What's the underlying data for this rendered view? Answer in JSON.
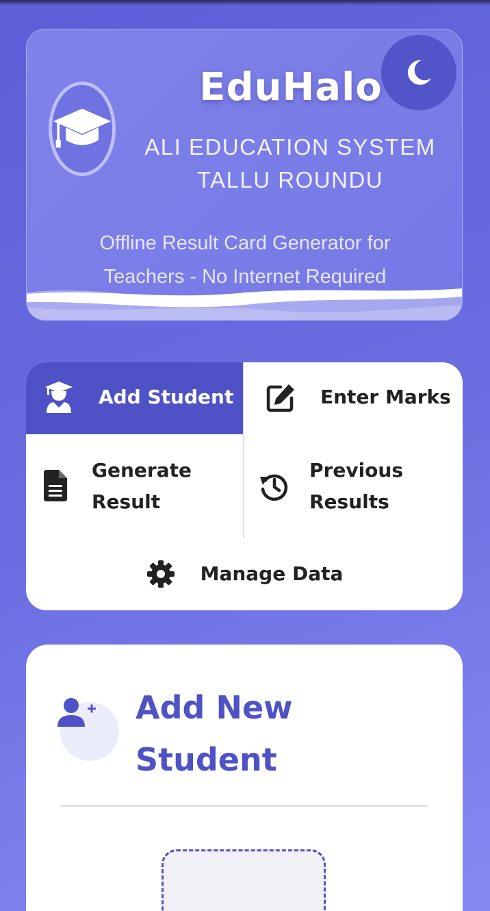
{
  "header": {
    "app_name": "EduHalo",
    "school_line1": "ALI EDUCATION SYSTEM",
    "school_line2": "TALLU ROUNDU",
    "tagline_line1": "Offline Result Card Generator for",
    "tagline_line2": "Teachers - No Internet Required",
    "logo_icon": "graduation-cap-icon",
    "theme_toggle_icon": "moon-icon"
  },
  "menu": {
    "add_student": "Add Student",
    "enter_marks": "Enter Marks",
    "generate_result_1": "Generate",
    "generate_result_2": "Result",
    "previous_results_1": "Previous",
    "previous_results_2": "Results",
    "manage_data": "Manage Data",
    "active_item": "Add Student"
  },
  "form": {
    "title_line1": "Add New",
    "title_line2": "Student"
  },
  "colors": {
    "accent": "#4f52c6",
    "background": "#6a6de0",
    "title": "#4e52c4"
  }
}
